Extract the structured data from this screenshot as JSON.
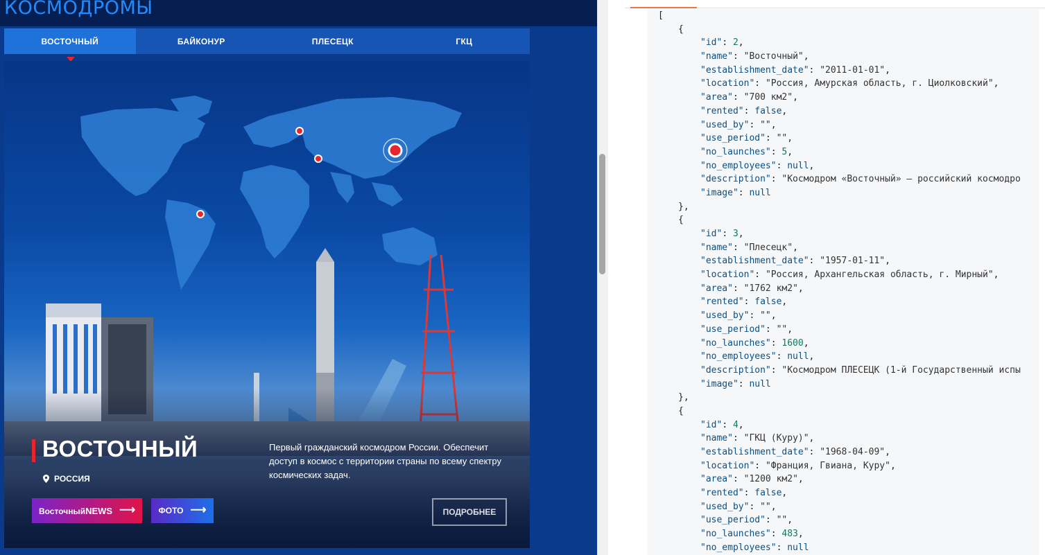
{
  "left_panel": {
    "header_title": "КОСМОДРОМЫ",
    "tabs": [
      {
        "label": "ВОСТОЧНЫЙ",
        "active": true
      },
      {
        "label": "БАЙКОНУР",
        "active": false
      },
      {
        "label": "ПЛЕСЕЦК",
        "active": false
      },
      {
        "label": "ГКЦ",
        "active": false
      }
    ],
    "hero": {
      "title": "ВОСТОЧНЫЙ",
      "country": "РОССИЯ",
      "description": "Первый гражданский космодром России. Обеспечит доступ в космос с территории страны по всему спектру космических задач.",
      "news_button_prefix": "Восточный",
      "news_button_suffix": "NEWS",
      "photo_button": "ФОТО",
      "more_button": "ПОДРОБНЕЕ"
    },
    "colors": {
      "accent_red": "#e5262d",
      "tab_bar": "#1755b4",
      "tab_active": "#1e72d9"
    }
  },
  "code_panel": {
    "open_bracket": "[",
    "records": [
      {
        "id": "2",
        "name": "\"Восточный\"",
        "establishment_date": "\"2011-01-01\"",
        "location": "\"Россия, Амурская область, г. Циолковский\"",
        "area": "\"700 км2\"",
        "rented": "false",
        "used_by": "\"\"",
        "use_period": "\"\"",
        "no_launches": "5",
        "no_employees": "null",
        "description": "\"Космодром «Восточный» — российский космодро",
        "image": "null"
      },
      {
        "id": "3",
        "name": "\"Плесецк\"",
        "establishment_date": "\"1957-01-11\"",
        "location": "\"Россия, Архангельская область, г. Мирный\"",
        "area": "\"1762 км2\"",
        "rented": "false",
        "used_by": "\"\"",
        "use_period": "\"\"",
        "no_launches": "1600",
        "no_employees": "null",
        "description": "\"Космодром ПЛЕСЕЦК (1-й Государственный испы",
        "image": "null"
      },
      {
        "id": "4",
        "name": "\"ГКЦ (Куру)\"",
        "establishment_date": "\"1968-04-09\"",
        "location": "\"Франция, Гвиана, Куру\"",
        "area": "\"1200 км2\"",
        "rented": "false",
        "used_by": "\"\"",
        "use_period": "\"\"",
        "no_launches": "483",
        "no_employees": "null"
      }
    ]
  }
}
